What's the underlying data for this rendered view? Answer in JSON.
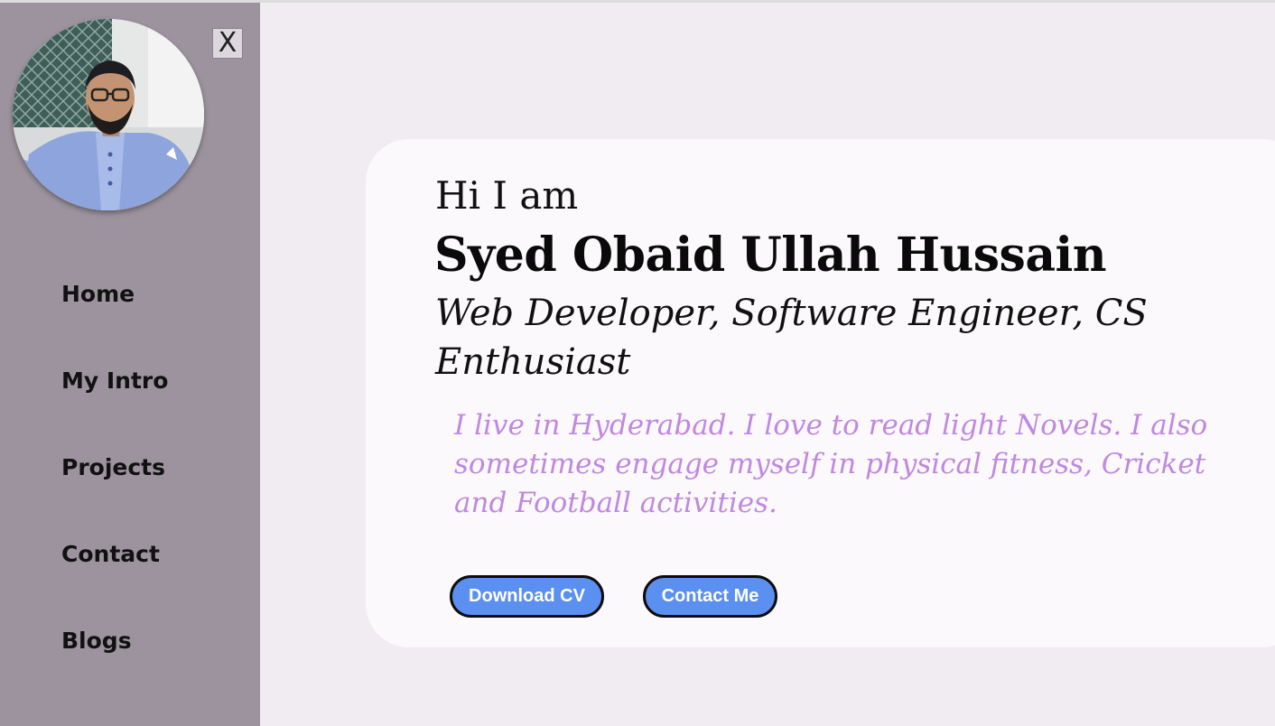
{
  "sidebar": {
    "close_label": "X",
    "nav": [
      {
        "label": "Home"
      },
      {
        "label": "My Intro"
      },
      {
        "label": "Projects"
      },
      {
        "label": "Contact"
      },
      {
        "label": "Blogs"
      }
    ]
  },
  "hero": {
    "greeting": "Hi I am",
    "name": "Syed Obaid Ullah Hussain",
    "role": "Web Developer, Software Engineer, CS Enthusiast",
    "bio": "I live in Hyderabad. I love to read light Novels. I also sometimes engage myself in physical fitness, Cricket and Football activities.",
    "buttons": {
      "download_cv": "Download CV",
      "contact_me": "Contact Me"
    }
  },
  "colors": {
    "sidebar_bg": "#9c939e",
    "page_bg": "#f0ecf1",
    "card_bg": "#fbf9fb",
    "bio_text": "#c088e0",
    "button_bg": "#5b8ff0"
  }
}
